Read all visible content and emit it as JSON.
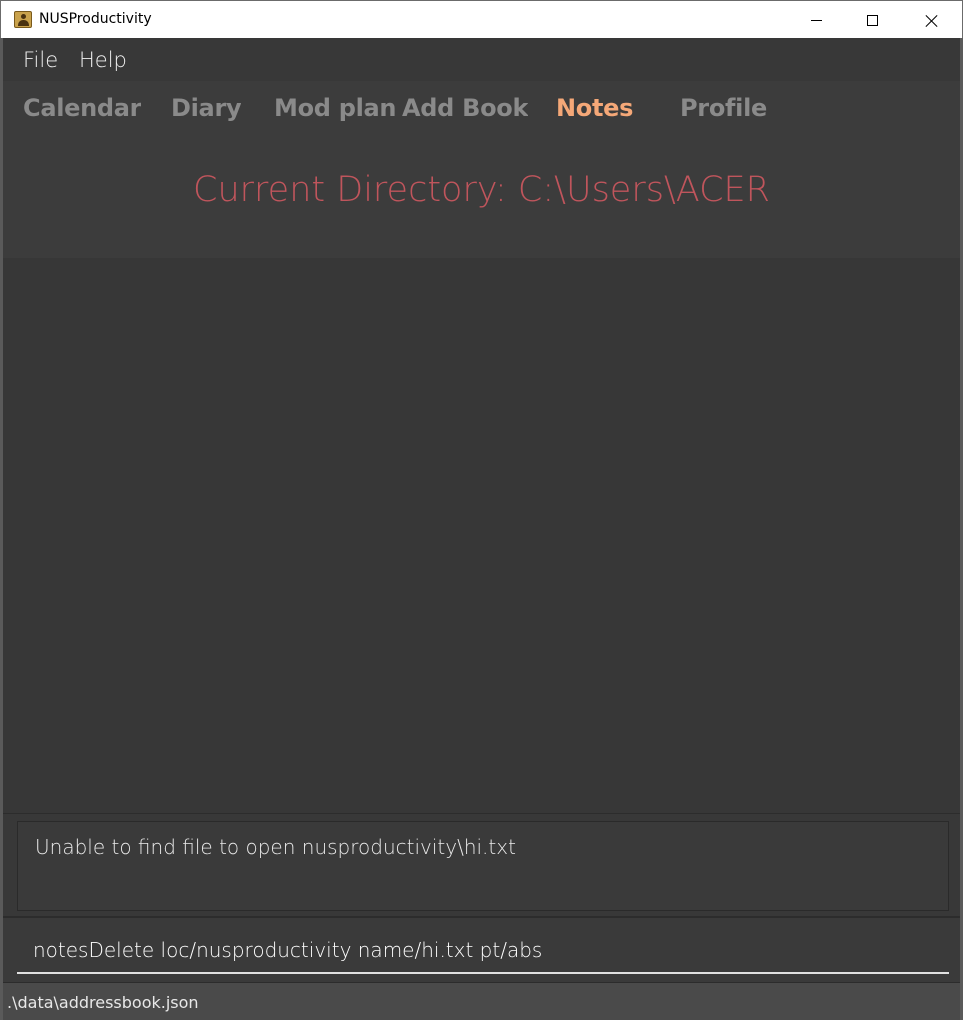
{
  "window": {
    "title": "NUSProductivity"
  },
  "menu": {
    "file_label": "File",
    "help_label": "Help"
  },
  "tabs": [
    {
      "label": "Calendar",
      "active": false
    },
    {
      "label": "Diary",
      "active": false
    },
    {
      "label": "Mod plan",
      "active": false
    },
    {
      "label": "Add Book",
      "active": false
    },
    {
      "label": "Notes",
      "active": true
    },
    {
      "label": "Profile",
      "active": false
    }
  ],
  "notes": {
    "current_directory": "Current Directory: C:\\Users\\ACER"
  },
  "result_display": {
    "text": "Unable to find file to open nusproductivity\\hi.txt"
  },
  "command_box": {
    "value": "notesDelete loc/nusproductivity name/hi.txt pt/abs"
  },
  "status_bar": {
    "path": ".\\data\\addressbook.json"
  },
  "colors": {
    "active_tab": "#f5a878",
    "inactive_tab": "#8a8a8a",
    "directory_text": "#c0555c",
    "background": "#3c3c3c"
  }
}
